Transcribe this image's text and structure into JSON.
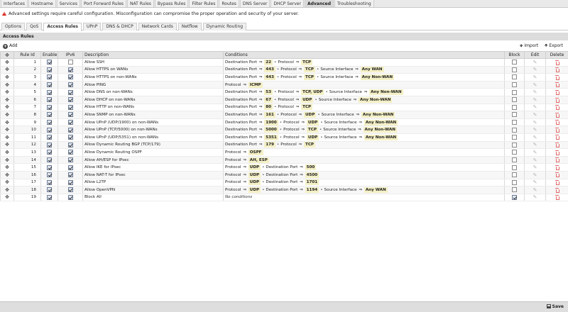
{
  "top_tabs": [
    "Interfaces",
    "Hostname",
    "Services",
    "Port Forward Rules",
    "NAT Rules",
    "Bypass Rules",
    "Filter Rules",
    "Routes",
    "DNS Server",
    "DHCP Server",
    "Advanced",
    "Troubleshooting"
  ],
  "active_top_tab": "Advanced",
  "warning": "Advanced settings require careful configuration. Misconfiguration can compromise the proper operation and security of your server.",
  "sub_tabs": [
    "Options",
    "QoS",
    "Access Rules",
    "UPnP",
    "DNS & DHCP",
    "Network Cards",
    "Netflow",
    "Dynamic Routing"
  ],
  "active_sub_tab": "Access Rules",
  "section_title": "Access Rules",
  "toolbar": {
    "add": "Add",
    "import": "Import",
    "export": "Export"
  },
  "table": {
    "headers": {
      "rule_id": "Rule Id",
      "enable": "Enable",
      "ipv6": "IPv6",
      "description": "Description",
      "conditions": "Conditions",
      "block": "Block",
      "edit": "Edit",
      "delete": "Delete"
    },
    "rows": [
      {
        "id": "1",
        "enable": true,
        "ipv6": false,
        "description": "Allow SSH",
        "block": false,
        "conditions": [
          {
            "k": "Destination Port",
            "v": "22"
          },
          {
            "k": "Protocol",
            "v": "TCP"
          }
        ]
      },
      {
        "id": "2",
        "enable": true,
        "ipv6": true,
        "description": "Allow HTTPS on WANs",
        "block": false,
        "conditions": [
          {
            "k": "Destination Port",
            "v": "443"
          },
          {
            "k": "Protocol",
            "v": "TCP"
          },
          {
            "k": "Source Interface",
            "v": "Any WAN"
          }
        ]
      },
      {
        "id": "3",
        "enable": true,
        "ipv6": true,
        "description": "Allow HTTPS on non-WANs",
        "block": false,
        "conditions": [
          {
            "k": "Destination Port",
            "v": "443"
          },
          {
            "k": "Protocol",
            "v": "TCP"
          },
          {
            "k": "Source Interface",
            "v": "Any Non-WAN"
          }
        ]
      },
      {
        "id": "4",
        "enable": true,
        "ipv6": true,
        "description": "Allow PING",
        "block": false,
        "conditions": [
          {
            "k": "Protocol",
            "v": "ICMP"
          }
        ]
      },
      {
        "id": "5",
        "enable": true,
        "ipv6": true,
        "description": "Allow DNS on non-WANs",
        "block": false,
        "conditions": [
          {
            "k": "Destination Port",
            "v": "53"
          },
          {
            "k": "Protocol",
            "v": "TCP, UDP"
          },
          {
            "k": "Source Interface",
            "v": "Any Non-WAN"
          }
        ]
      },
      {
        "id": "6",
        "enable": true,
        "ipv6": true,
        "description": "Allow DHCP on non-WANs",
        "block": false,
        "conditions": [
          {
            "k": "Destination Port",
            "v": "67"
          },
          {
            "k": "Protocol",
            "v": "UDP"
          },
          {
            "k": "Source Interface",
            "v": "Any Non-WAN"
          }
        ]
      },
      {
        "id": "7",
        "enable": true,
        "ipv6": true,
        "description": "Allow HTTP on non-WANs",
        "block": false,
        "conditions": [
          {
            "k": "Destination Port",
            "v": "80"
          },
          {
            "k": "Protocol",
            "v": "TCP"
          }
        ]
      },
      {
        "id": "8",
        "enable": true,
        "ipv6": true,
        "description": "Allow SNMP on non-WANs",
        "block": false,
        "conditions": [
          {
            "k": "Destination Port",
            "v": "161"
          },
          {
            "k": "Protocol",
            "v": "UDP"
          },
          {
            "k": "Source Interface",
            "v": "Any Non-WAN"
          }
        ]
      },
      {
        "id": "9",
        "enable": true,
        "ipv6": true,
        "description": "Allow UPnP (UDP/1900) on non-WANs",
        "block": false,
        "conditions": [
          {
            "k": "Destination Port",
            "v": "1900"
          },
          {
            "k": "Protocol",
            "v": "UDP"
          },
          {
            "k": "Source Interface",
            "v": "Any Non-WAN"
          }
        ]
      },
      {
        "id": "10",
        "enable": true,
        "ipv6": true,
        "description": "Allow UPnP (TCP/5000) on non-WANs",
        "block": false,
        "conditions": [
          {
            "k": "Destination Port",
            "v": "5000"
          },
          {
            "k": "Protocol",
            "v": "TCP"
          },
          {
            "k": "Source Interface",
            "v": "Any Non-WAN"
          }
        ]
      },
      {
        "id": "11",
        "enable": true,
        "ipv6": true,
        "description": "Allow UPnP (UDP/5351) on non-WANs",
        "block": false,
        "conditions": [
          {
            "k": "Destination Port",
            "v": "5351"
          },
          {
            "k": "Protocol",
            "v": "UDP"
          },
          {
            "k": "Source Interface",
            "v": "Any Non-WAN"
          }
        ]
      },
      {
        "id": "12",
        "enable": true,
        "ipv6": true,
        "description": "Allow Dynamic Routing BGP (TCP/179)",
        "block": false,
        "conditions": [
          {
            "k": "Destination Port",
            "v": "179"
          },
          {
            "k": "Protocol",
            "v": "TCP"
          }
        ]
      },
      {
        "id": "13",
        "enable": true,
        "ipv6": true,
        "description": "Allow Dynamic Routing OSPF",
        "block": false,
        "conditions": [
          {
            "k": "Protocol",
            "v": "OSPF"
          }
        ]
      },
      {
        "id": "14",
        "enable": true,
        "ipv6": true,
        "description": "Allow AH/ESP for IPsec",
        "block": false,
        "conditions": [
          {
            "k": "Protocol",
            "v": "AH, ESP"
          }
        ]
      },
      {
        "id": "15",
        "enable": true,
        "ipv6": true,
        "description": "Allow IKE for IPsec",
        "block": false,
        "conditions": [
          {
            "k": "Protocol",
            "v": "UDP"
          },
          {
            "k": "Destination Port",
            "v": "500"
          }
        ]
      },
      {
        "id": "16",
        "enable": true,
        "ipv6": true,
        "description": "Allow NAT-T for IPsec",
        "block": false,
        "conditions": [
          {
            "k": "Protocol",
            "v": "UDP"
          },
          {
            "k": "Destination Port",
            "v": "4500"
          }
        ]
      },
      {
        "id": "17",
        "enable": true,
        "ipv6": true,
        "description": "Allow L2TP",
        "block": false,
        "conditions": [
          {
            "k": "Protocol",
            "v": "UDP"
          },
          {
            "k": "Destination Port",
            "v": "1701"
          }
        ]
      },
      {
        "id": "18",
        "enable": true,
        "ipv6": true,
        "description": "Allow OpenVPN",
        "block": false,
        "conditions": [
          {
            "k": "Protocol",
            "v": "UDP"
          },
          {
            "k": "Destination Port",
            "v": "1194"
          },
          {
            "k": "Source Interface",
            "v": "Any WAN"
          }
        ]
      },
      {
        "id": "19",
        "enable": true,
        "ipv6": true,
        "description": "Block All",
        "block": true,
        "conditions": [],
        "no_conditions": "No conditions"
      }
    ]
  },
  "footer": {
    "save": "Save"
  },
  "icons": {
    "warning": "warning-icon",
    "add": "add-circle-icon",
    "import": "import-arrow-icon",
    "export": "export-arrow-icon",
    "drag": "drag-handle-icon",
    "edit": "pencil-icon",
    "delete": "trash-icon",
    "save": "disk-icon"
  },
  "colors": {
    "condition_value_bg": "#f4f0c6",
    "warning_icon": "#d9271c",
    "delete_icon": "#e06a6a"
  }
}
